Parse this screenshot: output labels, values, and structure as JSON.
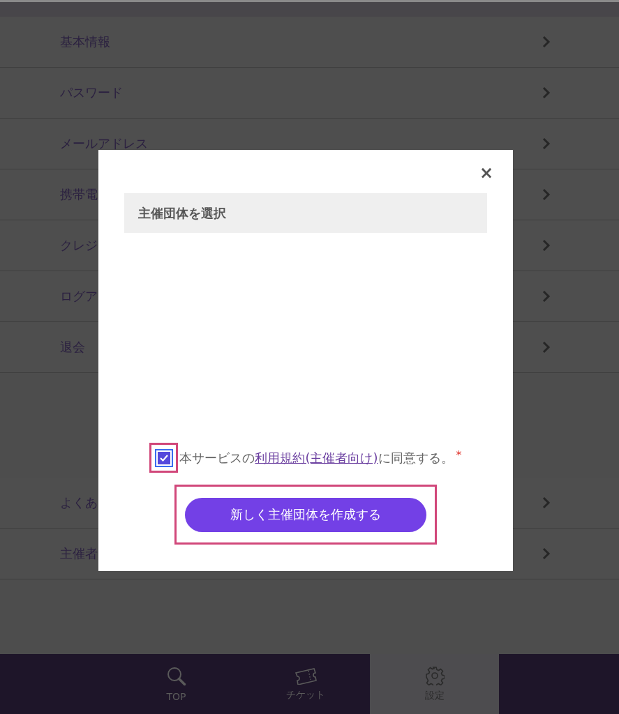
{
  "menu_groups": [
    {
      "items": [
        {
          "label": "基本情報"
        },
        {
          "label": "パスワード"
        },
        {
          "label": "メールアドレス"
        },
        {
          "label": "携帯電"
        },
        {
          "label": "クレジ"
        },
        {
          "label": "ログア"
        },
        {
          "label": "退会"
        }
      ]
    },
    {
      "items": [
        {
          "label": "よくあ"
        },
        {
          "label": "主催者"
        }
      ]
    }
  ],
  "bottom_nav": [
    {
      "label": "TOP",
      "selected": false
    },
    {
      "label": "チケット",
      "selected": false
    },
    {
      "label": "設定",
      "selected": true
    }
  ],
  "modal": {
    "close": "×",
    "title": "主催団体を選択",
    "agreement": {
      "checked": true,
      "before": "本サービスの",
      "link": "利用規約(主催者向け)",
      "after": "に同意する。",
      "required": "*"
    },
    "button": "新しく主催団体を作成する"
  }
}
